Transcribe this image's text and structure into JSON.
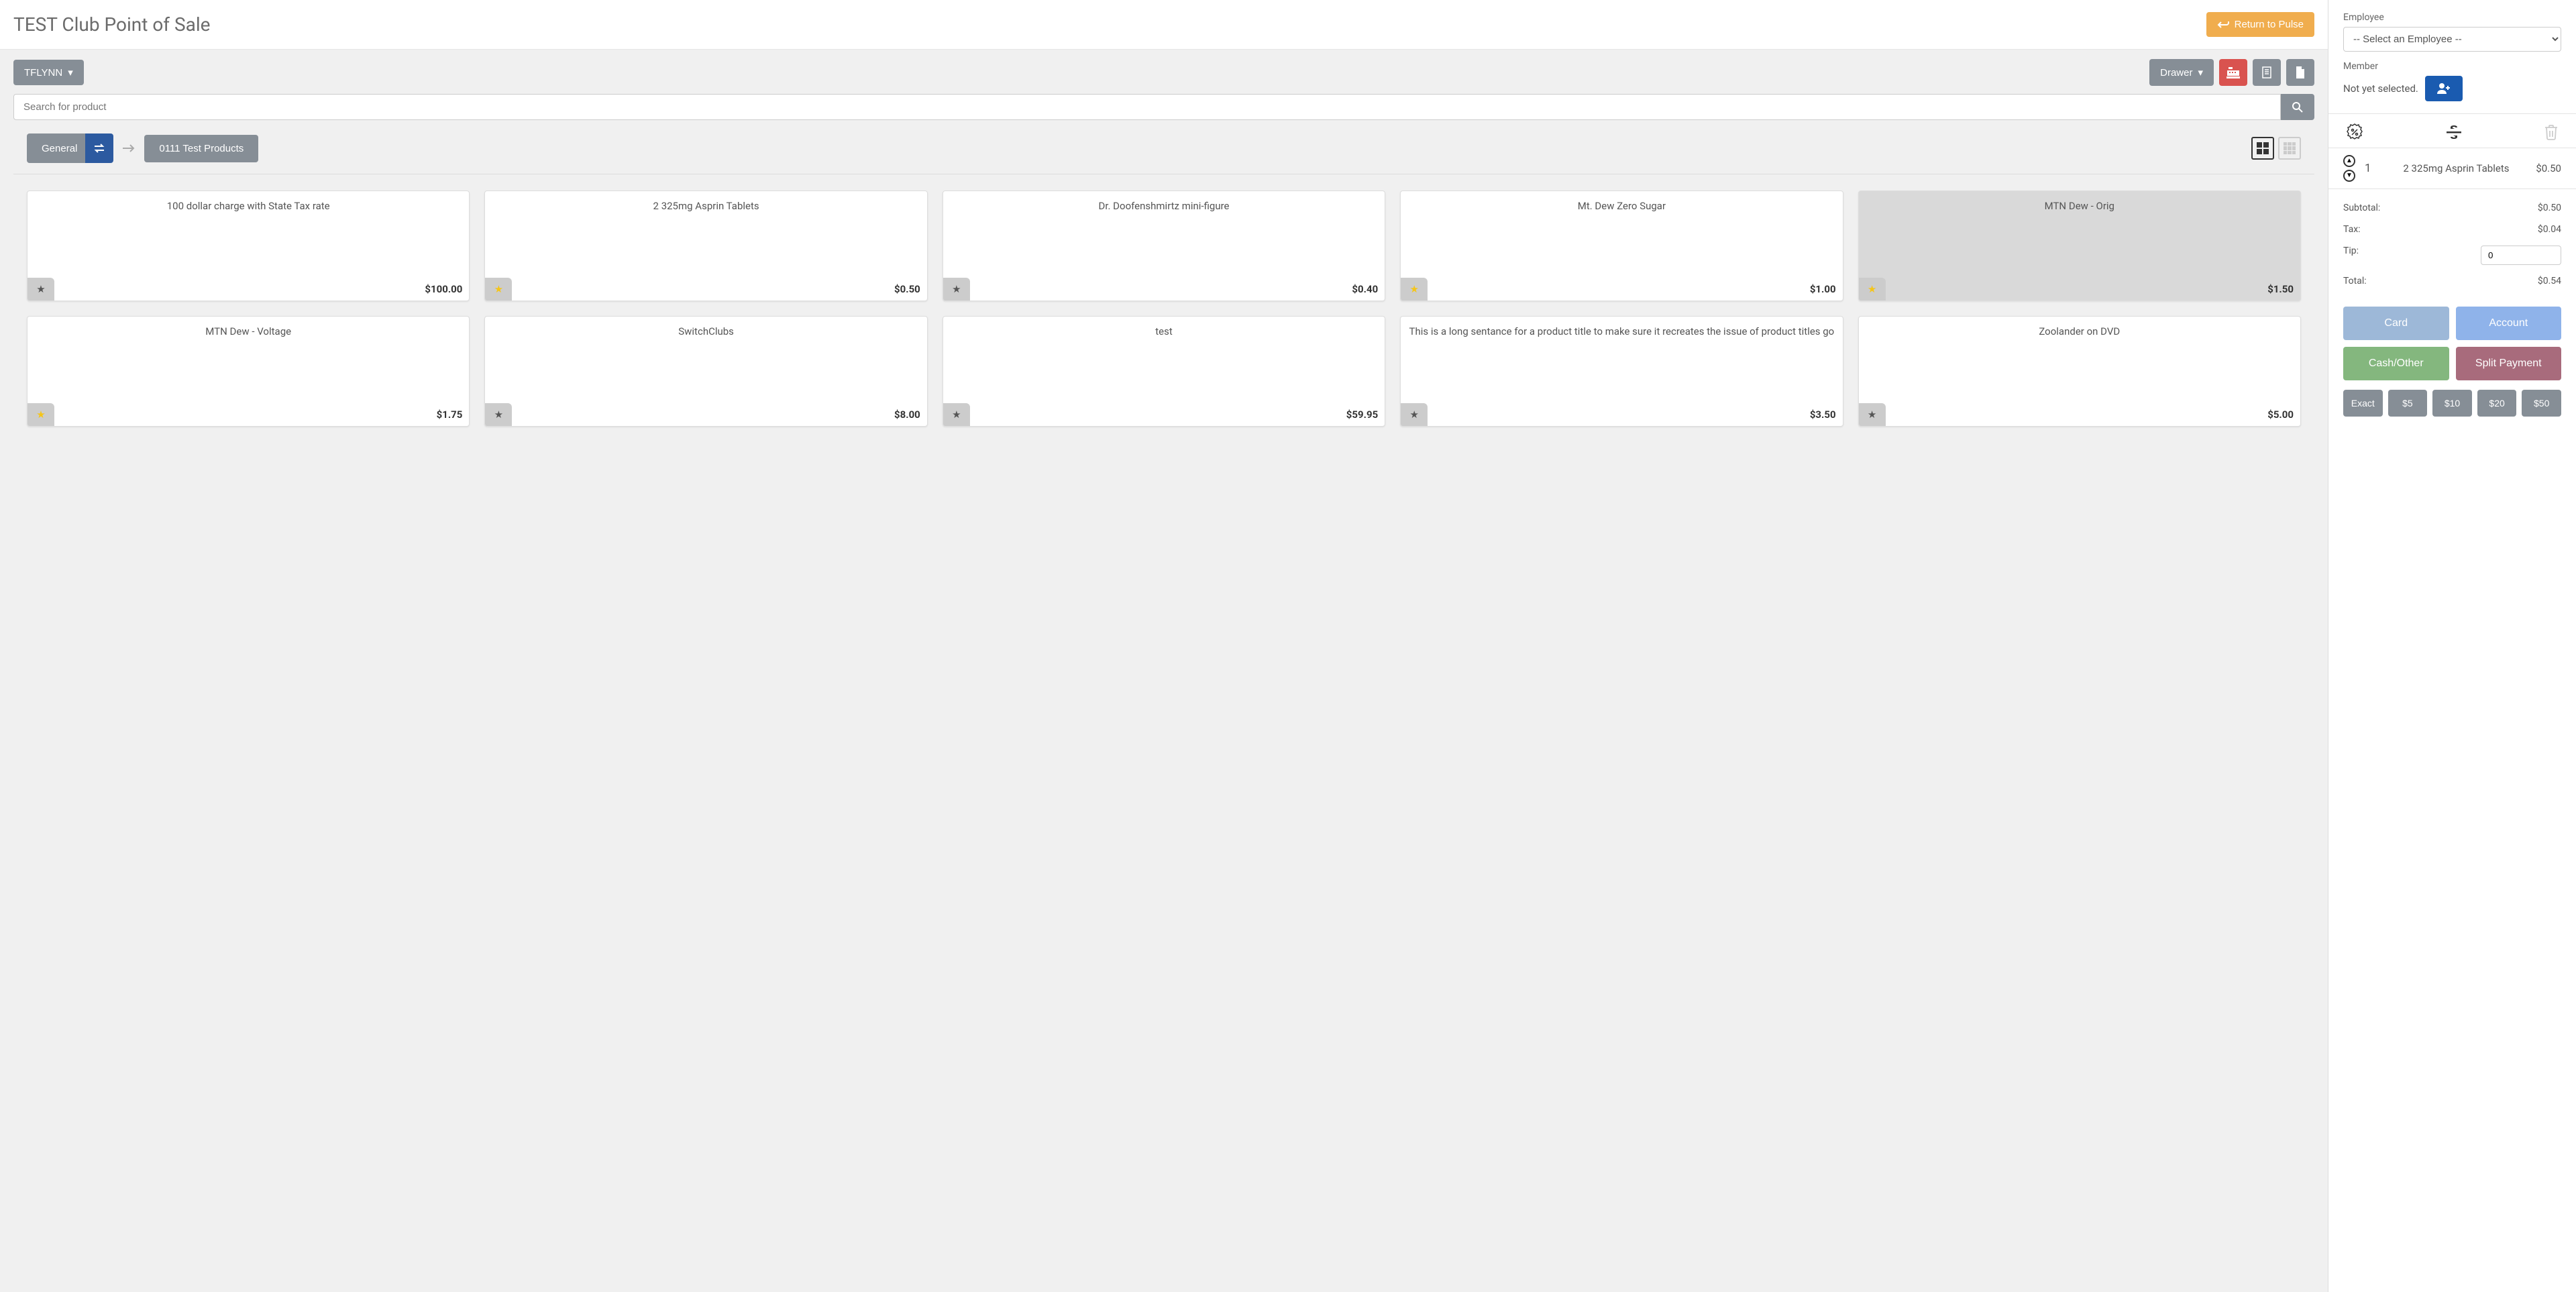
{
  "header": {
    "title": "TEST Club Point of Sale",
    "return_label": "Return to Pulse"
  },
  "toolbar": {
    "user": "TFLYNN",
    "drawer_label": "Drawer"
  },
  "search": {
    "placeholder": "Search for product"
  },
  "breadcrumb": {
    "root": "General",
    "current": "0111 Test Products"
  },
  "products": [
    {
      "name": "100 dollar charge with State Tax rate",
      "price": "$100.00",
      "fav": false,
      "selected": false
    },
    {
      "name": "2 325mg Asprin Tablets",
      "price": "$0.50",
      "fav": true,
      "selected": false
    },
    {
      "name": "Dr. Doofenshmirtz mini-figure",
      "price": "$0.40",
      "fav": false,
      "selected": false
    },
    {
      "name": "Mt. Dew Zero Sugar",
      "price": "$1.00",
      "fav": true,
      "selected": false
    },
    {
      "name": "MTN Dew - Orig",
      "price": "$1.50",
      "fav": true,
      "selected": true
    },
    {
      "name": "MTN Dew - Voltage",
      "price": "$1.75",
      "fav": true,
      "selected": false
    },
    {
      "name": "SwitchClubs",
      "price": "$8.00",
      "fav": false,
      "selected": false
    },
    {
      "name": "test",
      "price": "$59.95",
      "fav": false,
      "selected": false
    },
    {
      "name": "This is a long sentance for a product title to make sure it recreates the issue of product titles go",
      "price": "$3.50",
      "fav": false,
      "selected": false
    },
    {
      "name": "Zoolander on DVD",
      "price": "$5.00",
      "fav": false,
      "selected": false
    }
  ],
  "sidebar": {
    "employee_label": "Employee",
    "employee_placeholder": "-- Select an Employee --",
    "member_label": "Member",
    "member_status": "Not yet selected.",
    "cart": [
      {
        "qty": "1",
        "name": "2 325mg Asprin Tablets",
        "price": "$0.50"
      }
    ],
    "totals": {
      "subtotal_label": "Subtotal:",
      "subtotal": "$0.50",
      "tax_label": "Tax:",
      "tax": "$0.04",
      "tip_label": "Tip:",
      "tip_value": "0",
      "total_label": "Total:",
      "total": "$0.54"
    },
    "pay": {
      "card": "Card",
      "account": "Account",
      "cash": "Cash/Other",
      "split": "Split Payment"
    },
    "quick": [
      "Exact",
      "$5",
      "$10",
      "$20",
      "$50"
    ]
  }
}
